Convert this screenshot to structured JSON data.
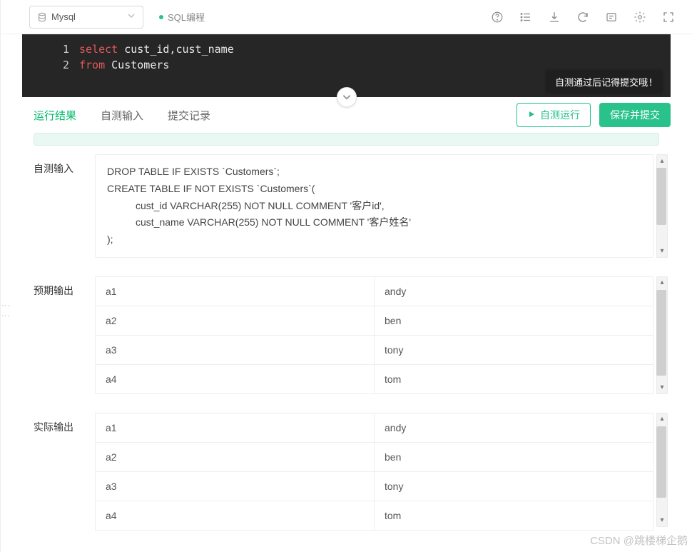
{
  "toolbar": {
    "databaseLabel": "Mysql",
    "modeLabel": "SQL编程"
  },
  "editor": {
    "lines": [
      {
        "n": "1",
        "kw": "select",
        "rest": " cust_id,cust_name"
      },
      {
        "n": "2",
        "kw": "from",
        "rest": " Customers"
      }
    ],
    "tooltip": "自测通过后记得提交哦!"
  },
  "tabs": {
    "result": "运行结果",
    "selfInput": "自测输入",
    "history": "提交记录"
  },
  "buttons": {
    "selfRun": "自测运行",
    "saveSubmit": "保存并提交"
  },
  "sections": {
    "selfInputLabel": "自测输入",
    "expectedLabel": "预期输出",
    "actualLabel": "实际输出",
    "selfInputText": {
      "l1": "DROP TABLE IF EXISTS `Customers`;",
      "l2": "CREATE TABLE IF NOT EXISTS `Customers`(",
      "l3": "cust_id VARCHAR(255) NOT NULL COMMENT '客户id',",
      "l4": "cust_name VARCHAR(255) NOT NULL COMMENT '客户姓名'",
      "l5": ");"
    },
    "expectedRows": [
      {
        "c1": "a1",
        "c2": "andy"
      },
      {
        "c1": "a2",
        "c2": "ben"
      },
      {
        "c1": "a3",
        "c2": "tony"
      },
      {
        "c1": "a4",
        "c2": "tom"
      }
    ],
    "actualRows": [
      {
        "c1": "a1",
        "c2": "andy"
      },
      {
        "c1": "a2",
        "c2": "ben"
      },
      {
        "c1": "a3",
        "c2": "tony"
      },
      {
        "c1": "a4",
        "c2": "tom"
      }
    ]
  },
  "watermark": "CSDN @跳楼梯企鹅"
}
